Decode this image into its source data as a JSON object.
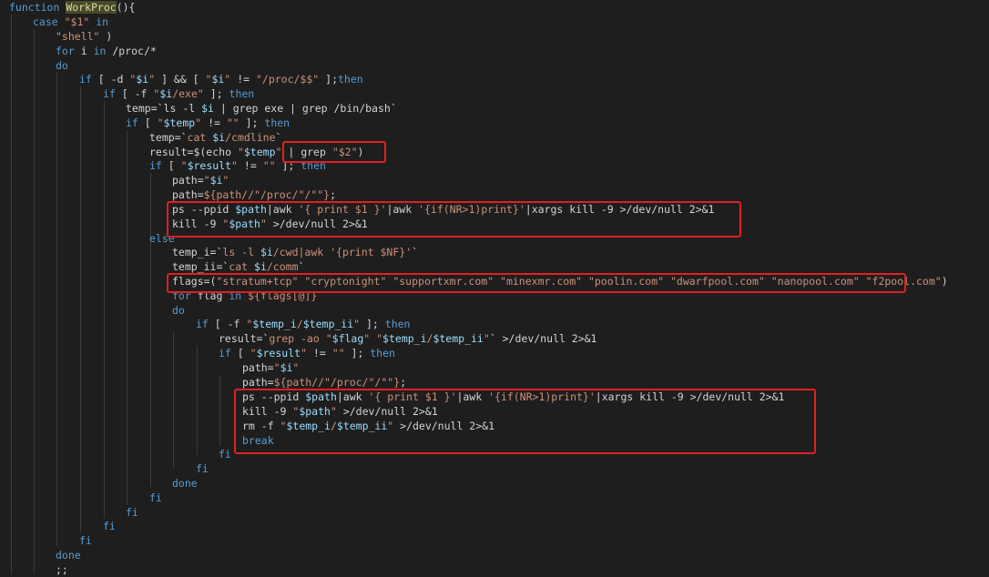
{
  "code": {
    "lines": [
      [
        [
          "k",
          "function "
        ],
        [
          "fh",
          "WorkProc"
        ],
        [
          "t",
          "(){"
        ]
      ],
      [
        [
          "k",
          "case "
        ],
        [
          "s",
          "\"$1\""
        ],
        [
          "k",
          " in"
        ]
      ],
      [
        [
          "s",
          "\"shell\""
        ],
        [
          "t",
          " )"
        ]
      ],
      [
        [
          "k",
          "for "
        ],
        [
          "t",
          "i "
        ],
        [
          "k",
          "in "
        ],
        [
          "t",
          "/proc/*"
        ]
      ],
      [
        [
          "k",
          "do"
        ]
      ],
      [
        [
          "k",
          "if "
        ],
        [
          "t",
          "[ -d "
        ],
        [
          "s",
          "\""
        ],
        [
          "v",
          "$i"
        ],
        [
          "s",
          "\""
        ],
        [
          "t",
          " ] && [ "
        ],
        [
          "s",
          "\""
        ],
        [
          "v",
          "$i"
        ],
        [
          "s",
          "\""
        ],
        [
          "t",
          " != "
        ],
        [
          "s",
          "\"/proc/$$\""
        ],
        [
          "t",
          " ];"
        ],
        [
          "k",
          "then"
        ]
      ],
      [
        [
          "k",
          "if "
        ],
        [
          "t",
          "[ -f "
        ],
        [
          "s",
          "\""
        ],
        [
          "v",
          "$i"
        ],
        [
          "s",
          "/exe\""
        ],
        [
          "t",
          " ]; "
        ],
        [
          "k",
          "then"
        ]
      ],
      [
        [
          "t",
          "temp=`"
        ],
        [
          "t",
          "ls -l "
        ],
        [
          "v",
          "$i"
        ],
        [
          "t",
          " | grep exe | grep /bin/bash`"
        ]
      ],
      [
        [
          "k",
          "if "
        ],
        [
          "t",
          "[ "
        ],
        [
          "s",
          "\""
        ],
        [
          "v",
          "$temp"
        ],
        [
          "s",
          "\""
        ],
        [
          "t",
          " != "
        ],
        [
          "s",
          "\"\""
        ],
        [
          "t",
          " ]; "
        ],
        [
          "k",
          "then"
        ]
      ],
      [
        [
          "t",
          "temp=`"
        ],
        [
          "s",
          "cat "
        ],
        [
          "v",
          "$i"
        ],
        [
          "s",
          "/cmdline"
        ],
        [
          "t",
          "`"
        ]
      ],
      [
        [
          "t",
          "result=$(echo "
        ],
        [
          "s",
          "\""
        ],
        [
          "v",
          "$temp"
        ],
        [
          "s",
          "\""
        ],
        [
          "t",
          " | grep "
        ],
        [
          "s",
          "\"$2\""
        ],
        [
          "t",
          ")"
        ]
      ],
      [
        [
          "k",
          "if "
        ],
        [
          "t",
          "[ "
        ],
        [
          "s",
          "\""
        ],
        [
          "v",
          "$result"
        ],
        [
          "s",
          "\""
        ],
        [
          "t",
          " != "
        ],
        [
          "s",
          "\"\""
        ],
        [
          "t",
          " ]; "
        ],
        [
          "k",
          "then"
        ]
      ],
      [
        [
          "t",
          "path="
        ],
        [
          "s",
          "\""
        ],
        [
          "v",
          "$i"
        ],
        [
          "s",
          "\""
        ]
      ],
      [
        [
          "t",
          "path="
        ],
        [
          "s",
          "${path//\"/proc/\"/\"\"}"
        ],
        [
          "t",
          ";"
        ]
      ],
      [
        [
          "t",
          "ps --ppid "
        ],
        [
          "v",
          "$path"
        ],
        [
          "t",
          "|awk "
        ],
        [
          "s",
          "'{ print $1 }'"
        ],
        [
          "t",
          "|awk "
        ],
        [
          "s",
          "'{if(NR>1)print}'"
        ],
        [
          "t",
          "|xargs kill -9 >/dev/null 2>&1"
        ]
      ],
      [
        [
          "t",
          "kill -9 "
        ],
        [
          "s",
          "\""
        ],
        [
          "v",
          "$path"
        ],
        [
          "s",
          "\""
        ],
        [
          "t",
          " >/dev/null 2>&1"
        ]
      ],
      [
        [
          "k",
          "else"
        ]
      ],
      [
        [
          "t",
          "temp_i=`"
        ],
        [
          "s",
          "ls -l "
        ],
        [
          "v",
          "$i"
        ],
        [
          "s",
          "/cwd|awk '{print $NF}'"
        ],
        [
          "t",
          "`"
        ]
      ],
      [
        [
          "t",
          "temp_ii=`"
        ],
        [
          "s",
          "cat "
        ],
        [
          "v",
          "$i"
        ],
        [
          "s",
          "/comm"
        ],
        [
          "t",
          "`"
        ]
      ],
      [
        [
          "t",
          "flags=("
        ],
        [
          "s",
          "\"stratum+tcp\" \"cryptonight\" \"supportxmr.com\" \"minexmr.com\" \"poolin.com\" \"dwarfpool.com\" \"nanopool.com\" \"f2pool.com\""
        ],
        [
          "t",
          ")"
        ]
      ],
      [
        [
          "k",
          "for "
        ],
        [
          "t",
          "flag "
        ],
        [
          "k",
          "in "
        ],
        [
          "s",
          "${flags[@]}"
        ]
      ],
      [
        [
          "k",
          "do"
        ]
      ],
      [
        [
          "k",
          "if "
        ],
        [
          "t",
          "[ -f "
        ],
        [
          "s",
          "\""
        ],
        [
          "v",
          "$temp_i"
        ],
        [
          "s",
          "/"
        ],
        [
          "v",
          "$temp_ii"
        ],
        [
          "s",
          "\""
        ],
        [
          "t",
          " ]; "
        ],
        [
          "k",
          "then"
        ]
      ],
      [
        [
          "t",
          "result=`"
        ],
        [
          "s",
          "grep -ao \""
        ],
        [
          "v",
          "$flag"
        ],
        [
          "s",
          "\" \""
        ],
        [
          "v",
          "$temp_i"
        ],
        [
          "s",
          "/"
        ],
        [
          "v",
          "$temp_ii"
        ],
        [
          "s",
          "\""
        ],
        [
          "t",
          "` >/dev/null 2>&1"
        ]
      ],
      [
        [
          "k",
          "if "
        ],
        [
          "t",
          "[ "
        ],
        [
          "s",
          "\""
        ],
        [
          "v",
          "$result"
        ],
        [
          "s",
          "\""
        ],
        [
          "t",
          " != "
        ],
        [
          "s",
          "\"\""
        ],
        [
          "t",
          " ]; "
        ],
        [
          "k",
          "then"
        ]
      ],
      [
        [
          "t",
          "path="
        ],
        [
          "s",
          "\""
        ],
        [
          "v",
          "$i"
        ],
        [
          "s",
          "\""
        ]
      ],
      [
        [
          "t",
          "path="
        ],
        [
          "s",
          "${path//\"/proc/\"/\"\"}"
        ],
        [
          "t",
          ";"
        ]
      ],
      [
        [
          "t",
          "ps --ppid "
        ],
        [
          "v",
          "$path"
        ],
        [
          "t",
          "|awk "
        ],
        [
          "s",
          "'{ print $1 }'"
        ],
        [
          "t",
          "|awk "
        ],
        [
          "s",
          "'{if(NR>1)print}'"
        ],
        [
          "t",
          "|xargs kill -9 >/dev/null 2>&1"
        ]
      ],
      [
        [
          "t",
          "kill -9 "
        ],
        [
          "s",
          "\""
        ],
        [
          "v",
          "$path"
        ],
        [
          "s",
          "\""
        ],
        [
          "t",
          " >/dev/null 2>&1"
        ]
      ],
      [
        [
          "t",
          "rm -f "
        ],
        [
          "s",
          "\""
        ],
        [
          "v",
          "$temp_i"
        ],
        [
          "s",
          "/"
        ],
        [
          "v",
          "$temp_ii"
        ],
        [
          "s",
          "\""
        ],
        [
          "t",
          " >/dev/null 2>&1"
        ]
      ],
      [
        [
          "k",
          "break"
        ]
      ],
      [
        [
          "k",
          "fi"
        ]
      ],
      [
        [
          "k",
          "fi"
        ]
      ],
      [
        [
          "k",
          "done"
        ]
      ],
      [
        [
          "k",
          "fi"
        ]
      ],
      [
        [
          "k",
          "fi"
        ]
      ],
      [
        [
          "k",
          "fi"
        ]
      ],
      [
        [
          "k",
          "fi"
        ]
      ],
      [
        [
          "k",
          "done"
        ]
      ],
      [
        [
          "t",
          ";;"
        ]
      ]
    ]
  },
  "colors": {
    "background": "#1e1e1e",
    "keyword": "#569cd6",
    "string": "#ce9178",
    "variable": "#9cdcfe",
    "function": "#dcdcaa",
    "plain": "#d4d4d4",
    "highlight_box": "#e02020"
  }
}
